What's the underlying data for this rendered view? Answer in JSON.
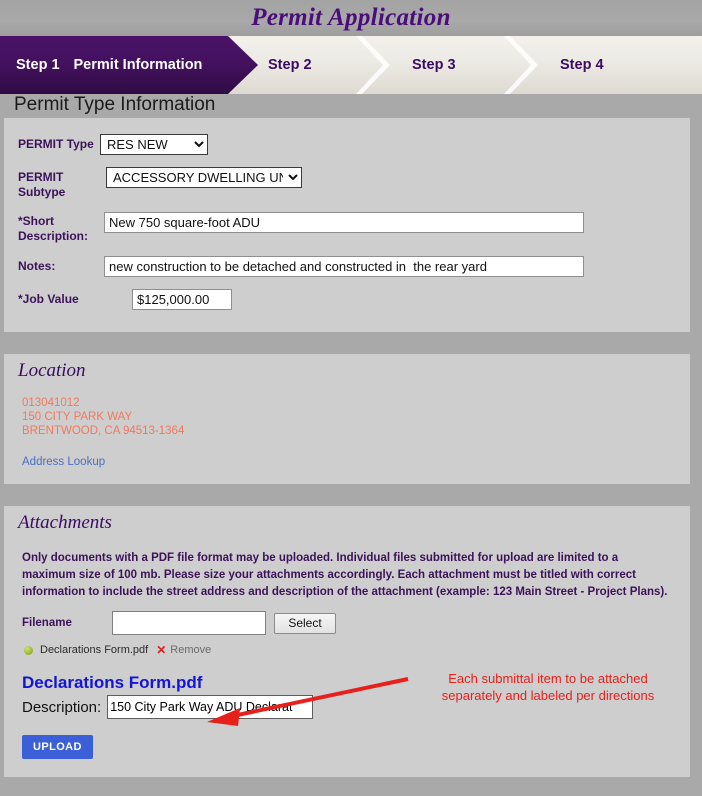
{
  "app": {
    "title": "Permit Application"
  },
  "steps": [
    {
      "num": "Step 1",
      "label": "Permit Information",
      "active": true
    },
    {
      "num": "Step 2",
      "label": "",
      "active": false
    },
    {
      "num": "Step 3",
      "label": "",
      "active": false
    },
    {
      "num": "Step 4",
      "label": "",
      "active": false
    }
  ],
  "permit_type_section": {
    "header": "Permit Type Information",
    "fields": {
      "permit_type_label": "PERMIT Type",
      "permit_type_value": "RES NEW",
      "permit_subtype_label_line1": "PERMIT",
      "permit_subtype_label_line2": "Subtype",
      "permit_subtype_value": "ACCESSORY DWELLING UNIT",
      "short_description_label_line1": "*Short",
      "short_description_label_line2": "Description:",
      "short_description_value": "New 750 square-foot ADU",
      "notes_label": "Notes:",
      "notes_value": "new construction to be detached and constructed in  the rear yard",
      "job_value_label": "*Job Value",
      "job_value_value": "$125,000.00"
    }
  },
  "location_section": {
    "title": "Location",
    "parcel": "013041012",
    "street": "150 CITY PARK WAY",
    "citystatezip": "BRENTWOOD, CA 94513-1364",
    "lookup_link": "Address Lookup"
  },
  "attachments_section": {
    "title": "Attachments",
    "instructions": "Only documents with a PDF file format may be uploaded.  Individual files submitted for upload are limited to a maximum size of 100 mb.  Please size your attachments accordingly.  Each attachment must be titled with correct information to include the street address and description of the attachment (example: 123 Main Street - Project Plans).",
    "filename_label": "Filename",
    "filename_value": "",
    "filename_placeholder": "",
    "select_button": "Select",
    "uploaded_file": {
      "name": "Declarations Form.pdf",
      "remove_label": "Remove",
      "status_icon": "green-dot-icon"
    },
    "document_title": "Declarations Form.pdf",
    "description_label": "Description:",
    "description_value": "150 City Park Way ADU Declarat",
    "upload_button": "UPLOAD"
  },
  "annotation": {
    "line1": "Each submittal item to be attached",
    "line2": "separately and labeled per directions",
    "color": "#e8201c"
  },
  "colors": {
    "accent_purple": "#4b0d7a",
    "label_purple": "#3c1259",
    "address_orange": "#f1795c",
    "link_blue": "#4a6fc0",
    "doc_blue": "#1414d8",
    "upload_blue": "#3b5fd6",
    "band_gray": "#a9a9a9",
    "panel_gray": "#cecece"
  }
}
